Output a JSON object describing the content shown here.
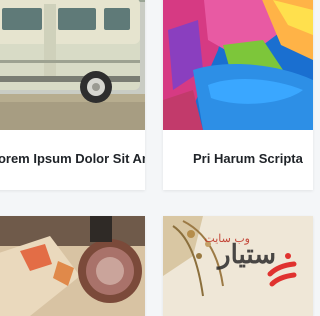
{
  "cards": [
    {
      "title": "Lorem Ipsum Dolor Sit Amet",
      "image": "vintage-bus-photo"
    },
    {
      "title": "Pri Harum Scripta",
      "image": "colorful-face-paint-photo"
    },
    {
      "title": "",
      "image": "map-and-glass-photo"
    },
    {
      "title": "",
      "image": "dried-flowers-photo"
    }
  ],
  "watermark": {
    "text": "ستیار",
    "sub_text": "وب سایت"
  },
  "colors": {
    "background": "#f4f6f8",
    "card": "#ffffff",
    "title": "#1f2328",
    "logo_red": "#e0322f"
  }
}
